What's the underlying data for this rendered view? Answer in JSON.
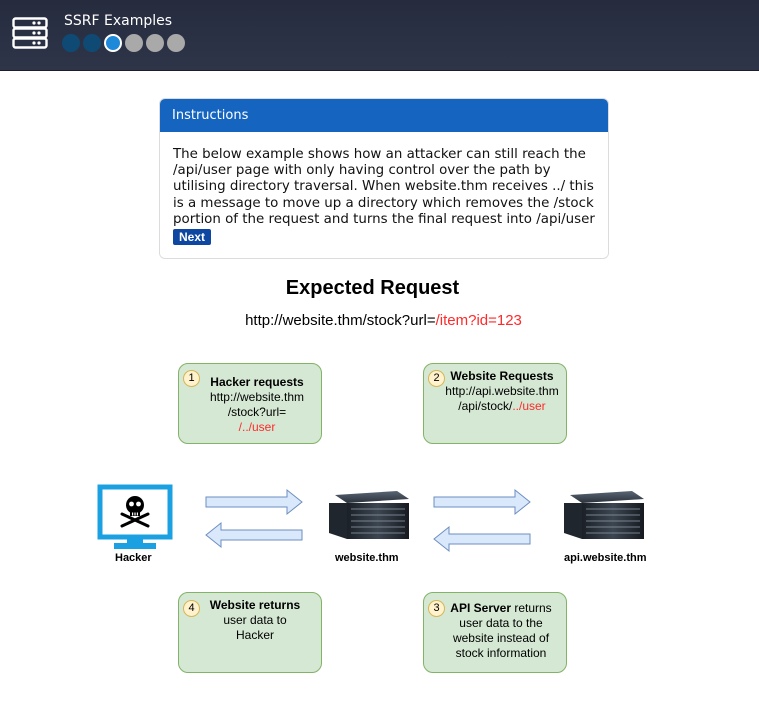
{
  "header": {
    "title": "SSRF Examples",
    "steps": [
      "done",
      "done",
      "current",
      "todo",
      "todo",
      "todo"
    ],
    "icon": "server-icon"
  },
  "instructions": {
    "heading": "Instructions",
    "body": "The below example shows how an attacker can still reach the /api/user page with only having control over the path by utilising directory traversal. When website.thm receives ../ this is a message to move up a directory which removes the /stock portion of the request and turns the final request into /api/user",
    "next_label": "Next"
  },
  "diagram": {
    "title": "Expected Request",
    "url_prefix": "http://website.thm/stock?url=",
    "url_highlight": "/item?id=123",
    "steps": {
      "s1": {
        "number": "1",
        "title": "Hacker requests",
        "line1": "http://website.thm",
        "line2": "/stock?url=",
        "highlight": "/../user"
      },
      "s2": {
        "number": "2",
        "title": "Website Requests",
        "line1": "http://api.website.thm",
        "line2": "/api/stock/",
        "highlight": "../user"
      },
      "s3": {
        "number": "3",
        "title": "API Server",
        "text_after": " returns",
        "line1": "user data to the",
        "line2": "website instead of",
        "line3": "stock information"
      },
      "s4": {
        "number": "4",
        "title": "Website returns",
        "line1": "user data to",
        "line2": "Hacker"
      }
    },
    "nodes": {
      "hacker": "Hacker",
      "website": "website.thm",
      "api": "api.website.thm"
    },
    "colors": {
      "step_fill": "#d5e8d4",
      "step_border": "#82b366",
      "badge_fill": "#fff2cc",
      "arrow_fill": "#dae8fc",
      "arrow_stroke": "#6c8ebf",
      "monitor": "#1ba1e2",
      "highlight": "#ff2a2a"
    }
  }
}
